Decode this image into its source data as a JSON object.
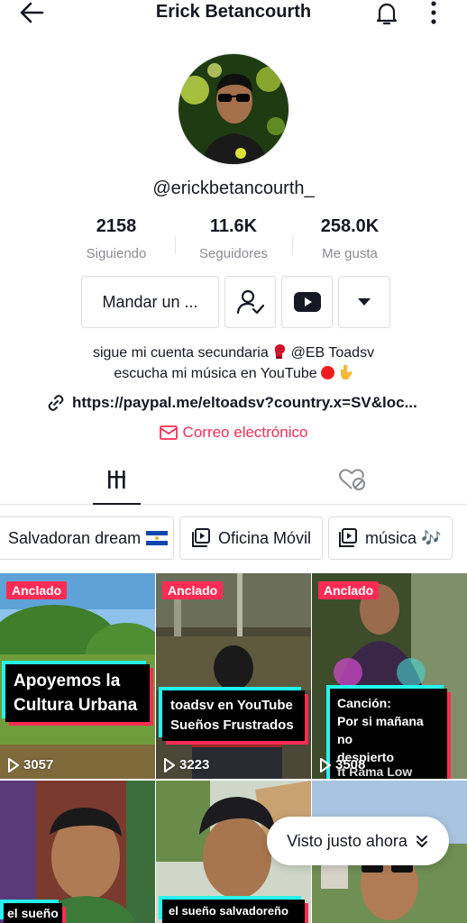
{
  "header": {
    "title": "Erick Betancourth",
    "back_icon": "arrow-left-icon",
    "bell_icon": "bell-icon",
    "more_icon": "more-vertical-icon"
  },
  "profile": {
    "username": "@erickbetancourth_",
    "stats": [
      {
        "value": "2158",
        "label": "Siguiendo"
      },
      {
        "value": "11.6K",
        "label": "Seguidores"
      },
      {
        "value": "258.0K",
        "label": "Me gusta"
      }
    ],
    "message_button": "Mandar un ...",
    "bio_line1": "sigue mi cuenta secundaria",
    "bio_line1_tail": "@EB Toadsv",
    "bio_line2": "escucha mi música en YouTube",
    "link": "https://paypal.me/eltoadsv?country.x=SV&loc...",
    "email": "Correo electrónico"
  },
  "playlists": [
    {
      "label": "Salvadoran dream"
    },
    {
      "label": "Oficina Móvil"
    },
    {
      "label": "música 🎶"
    }
  ],
  "videos": [
    {
      "badge": "Anclado",
      "caption": "Apoyemos la\nCultura Urbana",
      "views": "3057"
    },
    {
      "badge": "Anclado",
      "caption": "toadsv en YouTube\nSueños Frustrados",
      "views": "3223"
    },
    {
      "badge": "Anclado",
      "caption": "Canción:\nPor si mañana no\ndespierto",
      "caption_tail": "ft Rama Low",
      "views": "3508"
    },
    {
      "caption": "el sueño"
    },
    {
      "caption": "el sueño salvadoreño"
    },
    {}
  ],
  "toast": "Visto justo ahora",
  "colors": {
    "accent": "#fe2c55",
    "cyan": "#25f4ee",
    "text": "#161823",
    "muted": "#8a8b91"
  }
}
